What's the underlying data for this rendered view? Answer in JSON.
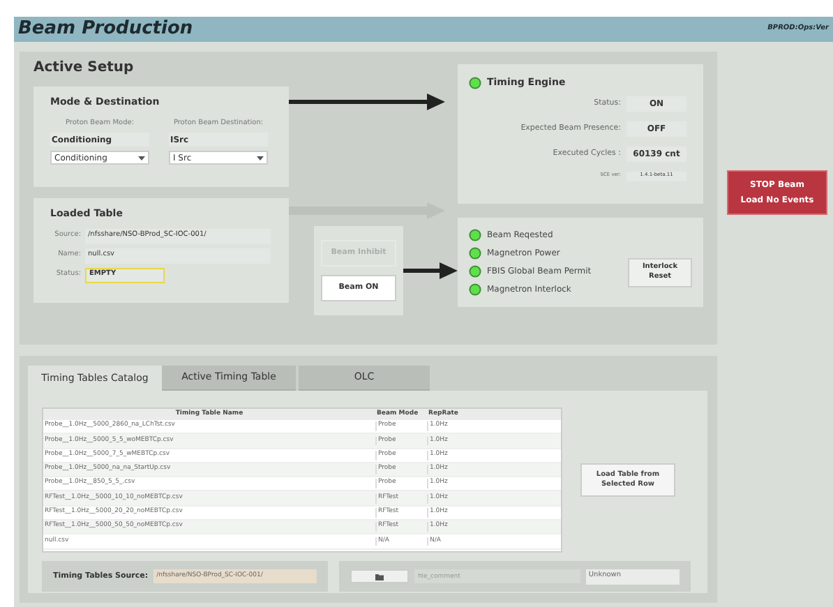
{
  "window": {
    "title": "Beam Production",
    "pv": "BPROD:Ops:Ver"
  },
  "active_setup": {
    "title": "Active Setup",
    "mode_destination": {
      "title": "Mode & Destination",
      "mode_label": "Proton Beam Mode:",
      "dest_label": "Proton Beam Destination:",
      "mode_value": "Conditioning",
      "dest_value": "ISrc",
      "mode_select": "Conditioning",
      "dest_select": "I Src"
    },
    "loaded_table": {
      "title": "Loaded Table",
      "fields": [
        {
          "label": "Source:",
          "value": "/nfsshare/NSO-BProd_SC-IOC-001/",
          "highlight": false
        },
        {
          "label": "Name:",
          "value": "null.csv",
          "highlight": false
        },
        {
          "label": "Status:",
          "value": "EMPTY",
          "highlight": true
        }
      ]
    },
    "links": [
      {
        "active": true
      },
      {
        "active": false
      },
      {
        "active": true
      }
    ],
    "beam_inhibit": {
      "label": "Beam Inhibit",
      "disabled": true
    },
    "beam_on": {
      "label": "Beam ON",
      "disabled": false
    },
    "timing_engine": {
      "title": "Timing Engine",
      "on": true,
      "fields": [
        {
          "label": "Status:",
          "value": "ON",
          "kind": "normal"
        },
        {
          "label": "Expected Beam Presence:",
          "value": "OFF",
          "kind": "normal"
        },
        {
          "label": "Executed Cycles :",
          "value": "60139 cnt",
          "kind": "normal"
        },
        {
          "label": "SCE ver:",
          "value": "1.4.1-beta.11",
          "kind": "small"
        }
      ]
    },
    "interlocks": [
      {
        "label": "Beam Reqested",
        "on": true
      },
      {
        "label": "Magnetron Power",
        "on": true
      },
      {
        "label": "FBIS Global Beam Permit",
        "on": true
      },
      {
        "label": "Magnetron Interlock",
        "on": true
      }
    ],
    "reset_button": {
      "lines": [
        "Interlock",
        "Reset"
      ]
    }
  },
  "stop_button": {
    "lines": [
      "STOP Beam",
      "Load No Events"
    ]
  },
  "catalog": {
    "tabs": [
      {
        "label": "Timing Tables Catalog",
        "selected": true
      },
      {
        "label": "Active Timing Table",
        "selected": false
      },
      {
        "label": "OLC",
        "selected": false
      }
    ],
    "table": {
      "columns": [
        "Timing Table Name",
        "Beam Mode",
        "RepRate"
      ],
      "rows": [
        [
          "Probe__1.0Hz__5000_2860_na_LChTst.csv",
          "Probe",
          "1.0Hz"
        ],
        [
          "Probe__1.0Hz__5000_5_5_woMEBTCp.csv",
          "Probe",
          "1.0Hz"
        ],
        [
          "Probe__1.0Hz__5000_7_5_wMEBTCp.csv",
          "Probe",
          "1.0Hz"
        ],
        [
          "Probe__1.0Hz__5000_na_na_StartUp.csv",
          "Probe",
          "1.0Hz"
        ],
        [
          "Probe__1.0Hz__850_5_5_.csv",
          "Probe",
          "1.0Hz"
        ],
        [
          "RFTest__1.0Hz__5000_10_10_noMEBTCp.csv",
          "RFTest",
          "1.0Hz"
        ],
        [
          "RFTest__1.0Hz__5000_20_20_noMEBTCp.csv",
          "RFTest",
          "1.0Hz"
        ],
        [
          "RFTest__1.0Hz__5000_50_50_noMEBTCp.csv",
          "RFTest",
          "1.0Hz"
        ],
        [
          "null.csv",
          "N/A",
          "N/A"
        ]
      ]
    },
    "load_button": {
      "lines": [
        "Load Table from",
        "Selected Row"
      ]
    },
    "source_label": "Timing Tables Source:",
    "source_value": "/nfsshare/NSO-BProd_SC-IOC-001/",
    "comment_placeholder": "file_comment",
    "status_value": "Unknown"
  }
}
